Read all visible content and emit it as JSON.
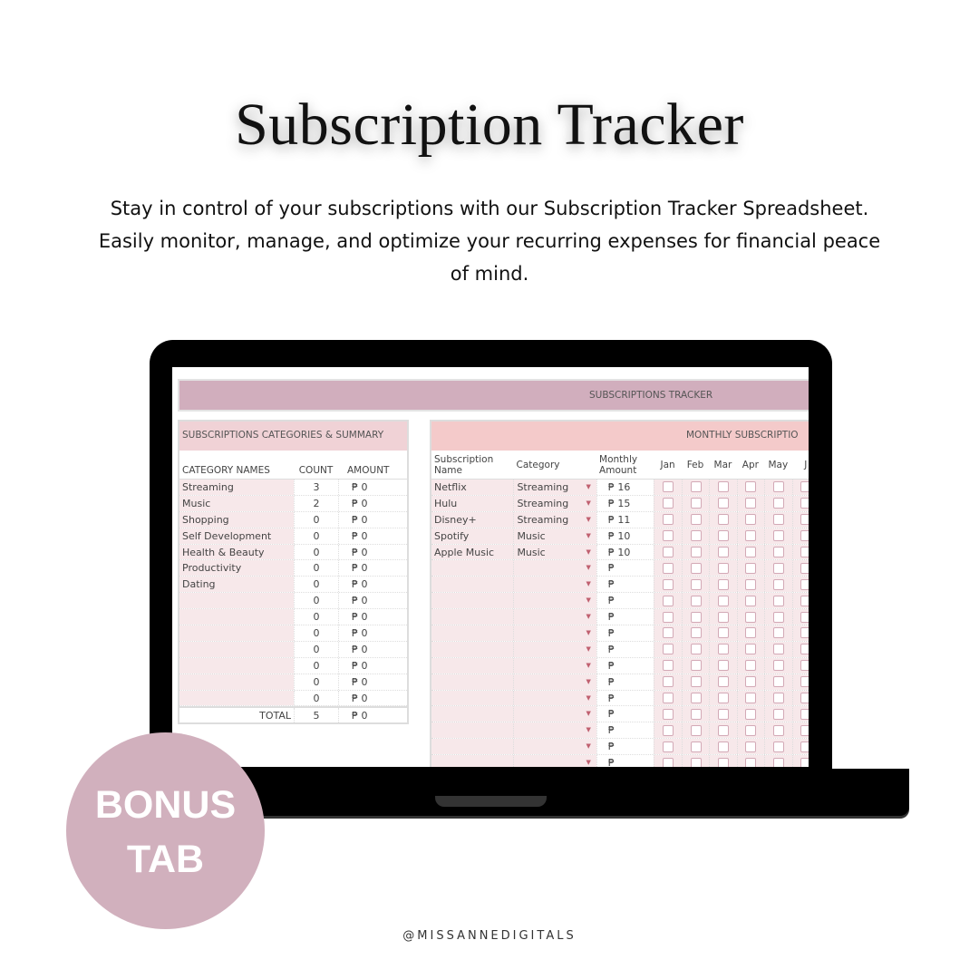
{
  "title": "Subscription Tracker",
  "description": "Stay in control of your subscriptions with our Subscription Tracker Spreadsheet. Easily monitor, manage, and optimize your recurring expenses for financial peace of mind.",
  "sheet": {
    "banner": "SUBSCRIPTIONS TRACKER",
    "summary": {
      "header": "SUBSCRIPTIONS CATEGORIES & SUMMARY",
      "columns": [
        "CATEGORY NAMES",
        "COUNT",
        "AMOUNT"
      ],
      "rows": [
        {
          "name": "Streaming",
          "count": "3",
          "amount": "₱ 0"
        },
        {
          "name": "Music",
          "count": "2",
          "amount": "₱ 0"
        },
        {
          "name": "Shopping",
          "count": "0",
          "amount": "₱ 0"
        },
        {
          "name": "Self Development",
          "count": "0",
          "amount": "₱ 0"
        },
        {
          "name": "Health & Beauty",
          "count": "0",
          "amount": "₱ 0"
        },
        {
          "name": "Productivity",
          "count": "0",
          "amount": "₱ 0"
        },
        {
          "name": "Dating",
          "count": "0",
          "amount": "₱ 0"
        },
        {
          "name": "",
          "count": "0",
          "amount": "₱ 0"
        },
        {
          "name": "",
          "count": "0",
          "amount": "₱ 0"
        },
        {
          "name": "",
          "count": "0",
          "amount": "₱ 0"
        },
        {
          "name": "",
          "count": "0",
          "amount": "₱ 0"
        },
        {
          "name": "",
          "count": "0",
          "amount": "₱ 0"
        },
        {
          "name": "",
          "count": "0",
          "amount": "₱ 0"
        },
        {
          "name": "",
          "count": "0",
          "amount": "₱ 0"
        }
      ],
      "total": {
        "label": "TOTAL",
        "count": "5",
        "amount": "₱ 0"
      }
    },
    "monthly": {
      "header": "MONTHLY SUBSCRIPTIO",
      "columns": [
        "Subscription Name",
        "Category",
        "Monthly Amount"
      ],
      "months": [
        "Jan",
        "Feb",
        "Mar",
        "Apr",
        "May",
        "J"
      ],
      "rows": [
        {
          "name": "Netflix",
          "category": "Streaming",
          "amount": "₱ 16"
        },
        {
          "name": "Hulu",
          "category": "Streaming",
          "amount": "₱ 15"
        },
        {
          "name": "Disney+",
          "category": "Streaming",
          "amount": "₱ 11"
        },
        {
          "name": "Spotify",
          "category": "Music",
          "amount": "₱ 10"
        },
        {
          "name": "Apple Music",
          "category": "Music",
          "amount": "₱ 10"
        },
        {
          "name": "",
          "category": "",
          "amount": "₱"
        },
        {
          "name": "",
          "category": "",
          "amount": "₱"
        },
        {
          "name": "",
          "category": "",
          "amount": "₱"
        },
        {
          "name": "",
          "category": "",
          "amount": "₱"
        },
        {
          "name": "",
          "category": "",
          "amount": "₱"
        },
        {
          "name": "",
          "category": "",
          "amount": "₱"
        },
        {
          "name": "",
          "category": "",
          "amount": "₱"
        },
        {
          "name": "",
          "category": "",
          "amount": "₱"
        },
        {
          "name": "",
          "category": "",
          "amount": "₱"
        },
        {
          "name": "",
          "category": "",
          "amount": "₱"
        },
        {
          "name": "",
          "category": "",
          "amount": "₱"
        },
        {
          "name": "",
          "category": "",
          "amount": "₱"
        },
        {
          "name": "",
          "category": "",
          "amount": "₱"
        }
      ]
    }
  },
  "badge": {
    "line1": "BONUS",
    "line2": "TAB",
    "color": "#d1b0bd"
  },
  "handle": "@MISSANNEDIGITALS"
}
